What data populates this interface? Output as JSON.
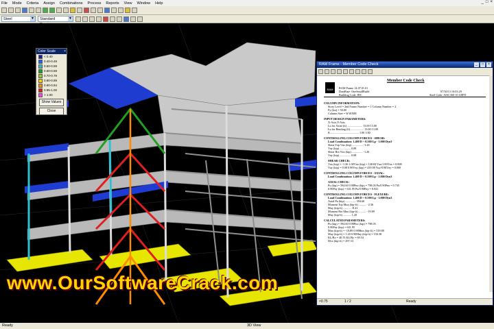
{
  "menu": [
    "File",
    "Mode",
    "Criteria",
    "Assign",
    "Combinations",
    "Process",
    "Reports",
    "View",
    "Window",
    "Help"
  ],
  "window_controls": [
    "_",
    "□",
    "×"
  ],
  "toolbar": {
    "material_select": "Steel",
    "provisions_select": "Standard Provisions"
  },
  "color_scale": {
    "title": "Color Scale",
    "close_glyph": "×",
    "rows": [
      {
        "label": "< 0.40",
        "color": "#1f1f9f"
      },
      {
        "label": "0.40-0.49",
        "color": "#2060ff"
      },
      {
        "label": "0.50-0.59",
        "color": "#2fbfd0"
      },
      {
        "label": "0.60-0.69",
        "color": "#1fa01f"
      },
      {
        "label": "0.70-0.79",
        "color": "#8fd02f"
      },
      {
        "label": "0.80-0.89",
        "color": "#ffd000"
      },
      {
        "label": "0.90-0.94",
        "color": "#ff8c00"
      },
      {
        "label": "0.95-1.00",
        "color": "#e02020"
      },
      {
        "label": "> 1.00",
        "color": "#ff40ff"
      }
    ],
    "show_values": "Show Values",
    "close": "Close"
  },
  "member_window": {
    "title": "RAM Frame - Member Code Check",
    "controls": [
      "_",
      "□",
      "×"
    ],
    "zoom": "×0.75",
    "page": "1 / 2",
    "status": "Ready"
  },
  "report": {
    "logo": "RAM",
    "heading": "Member Code Check",
    "app_line": "RAM Frame 14.07.01.01",
    "database_line": "DataBase: OneSmallBuild",
    "building_code_line": "Building Code: IBC",
    "date_line": "07/30/13  10:03:29",
    "steel_code_line": "Steel Code: AISC360-10 LRFD",
    "sections": [
      {
        "title": "COLUMN INFORMATION:",
        "rows": [
          "Story Level     =  2nd          Frame Number  =  1          Column Number  =  2",
          "Fy (ksi)          =  50.00",
          "Column Size     =  W10X88"
        ]
      },
      {
        "title": "INPUT DESIGN PARAMETERS:",
        "rows": [
          "                                                       X-Axis            Y-Axis",
          "Lu for Axial (ft) .....................       13.00             13.00",
          "Lu for Bending (ft) ..................       13.00             13.00",
          "K .......................................        1.00               1.00"
        ]
      },
      {
        "title": "CONTROLLING COLUMN FORCES - SHEAR:",
        "rows": [
          "Load Combination: 1.400 D + 0.500 Lp - 1.000 Dyn3",
          "Shear    Top        Vux (kip) ...............       -1.26",
          "                        Vuy (kip) ...............        0.08",
          "Shear    Bot        Vux (kip) ...............       -1.26",
          "                        Vuy (kip) ...............        0.08"
        ]
      },
      {
        "title": "SHEAR CHECK:",
        "rows": [
          "Vux (kip)   =   -1.26     1.00Vnx (kip)  =  148.84     Vux/1.00Vnx  =  0.008",
          "Vuy (kip)   =    0.08     0.90Vny (kip)  =  419.98     Vuy/0.90Vny  =  0.000"
        ]
      },
      {
        "title": "CONTROLLING COLUMN FORCES - AXIAL:",
        "rows": [
          "Load Combination: 1.400 D + 0.500 Lp - 1.000 Dyn3"
        ]
      },
      {
        "title": "AXIAL CHECK:",
        "rows": [
          "Pu (kip)    =   594.60     0.90Pnx (kip)  =  798.03     Pu/0.90Pnx  =  0.745",
          "                                0.90Pny (kip)  =  631.95     Pu/0.90Pny  =  0.941"
        ]
      },
      {
        "title": "CONTROLLING COLUMN FORCES - FLEXURE:",
        "rows": [
          "Load Combination: 1.400 D + 0.500 Lp - 1.000 Dyn3",
          "Axial                      Pu (kip) ...............      594.60",
          "Moment    Top          Mux (kip-ft) ...........       -2.36",
          "                          Muy (kip-ft) ...........       -0.41",
          "Moment    Bot          Mux (kip-ft) ...........      -19.89",
          "                          Muy (kip-ft) ...........        1.20"
        ]
      },
      {
        "title": "CALCULATED PARAMETERS:",
        "rows": [
          "Pu (kip)         =   594.60     0.90Pnx (kip)    =   798.03",
          "                                       0.90Pny (kip)    =   631.95",
          "Mux (kip-ft)    =   -19.89     0.90Mnx (kip-ft)  =   319.88",
          "Muy (kip-ft)    =     1.20     0.90Mny (kip-ft)  =   150.38",
          "KL/Rx            =    40.55     KL/Ry               =    69.54",
          "                                       Mcx (kip-ft)      =   297.33"
        ]
      }
    ]
  },
  "status": {
    "left": "Ready",
    "center": "3D View"
  },
  "watermark": "www.OurSoftwareCrack.com"
}
